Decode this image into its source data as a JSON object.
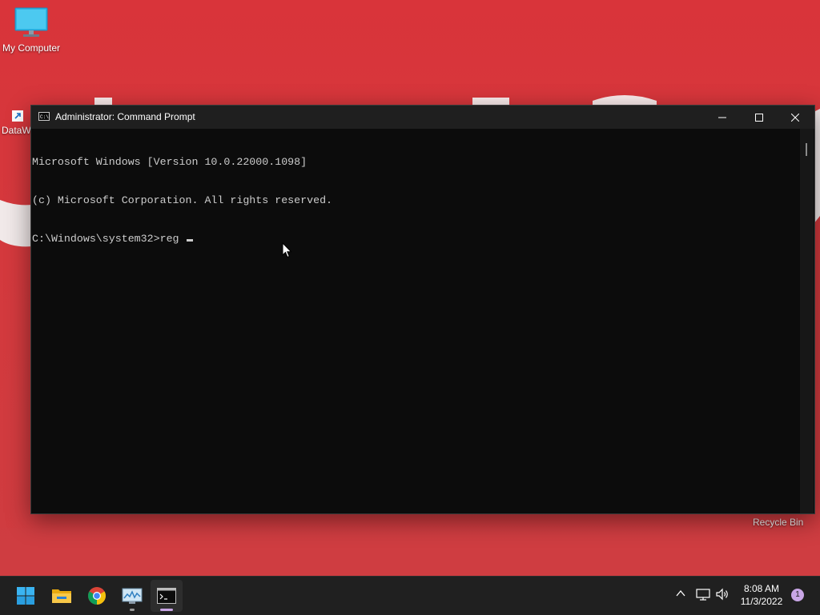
{
  "desktop": {
    "icons": [
      {
        "label": "My Computer",
        "icon": "monitor-icon"
      },
      {
        "label": "DataW",
        "icon": "shortcut-arrow-icon"
      },
      {
        "label": "Recycle Bin",
        "icon": "recycle-bin-icon"
      }
    ],
    "wallpaper_color": "#d2383d"
  },
  "window": {
    "title": "Administrator: Command Prompt",
    "icon": "cmd-icon",
    "controls": [
      "minimize-icon",
      "maximize-icon",
      "close-icon"
    ],
    "console_lines": [
      "Microsoft Windows [Version 10.0.22000.1098]",
      "(c) Microsoft Corporation. All rights reserved.",
      "C:\\Windows\\system32>reg "
    ],
    "colors": {
      "background": "#0c0c0c",
      "text": "#cccccc",
      "titlebar": "#1f1f1f"
    }
  },
  "taskbar": {
    "apps": [
      {
        "name": "start",
        "icon": "windows-start-icon"
      },
      {
        "name": "file-explorer",
        "icon": "folder-icon"
      },
      {
        "name": "chrome",
        "icon": "chrome-icon"
      },
      {
        "name": "performance-monitor",
        "icon": "monitor-chart-icon"
      },
      {
        "name": "command-prompt",
        "icon": "cmd-icon",
        "active": true
      }
    ],
    "tray": {
      "icons": [
        "chevron-up-icon",
        "network-icon",
        "volume-icon"
      ],
      "time": "8:08 AM",
      "date": "11/3/2022",
      "notification_count": "1"
    }
  }
}
